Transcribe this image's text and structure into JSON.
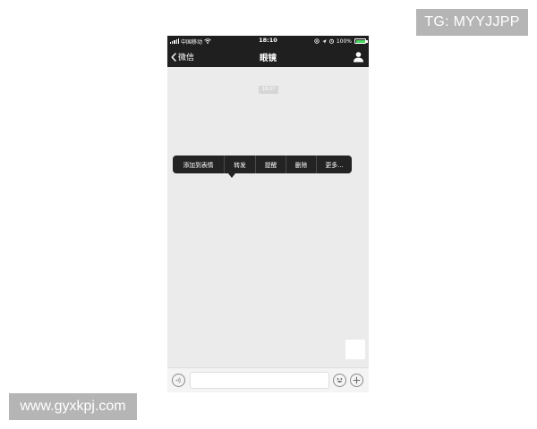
{
  "watermarks": {
    "top": "TG: MYYJJPP",
    "bottom": "www.gyxkpj.com"
  },
  "status_bar": {
    "carrier": "中国移动",
    "time": "18:10",
    "battery": "100%",
    "battery_level": 1.0
  },
  "nav": {
    "back_label": "微信",
    "title": "眼镜"
  },
  "chat": {
    "timestamp": "18:07"
  },
  "context_menu": {
    "items": [
      "添加到表情",
      "转发",
      "提醒",
      "删除",
      "更多..."
    ]
  },
  "input_bar": {
    "message_value": ""
  },
  "icons": {
    "back": "chevron-left-icon",
    "profile": "person-icon",
    "voice": "voice-icon",
    "emoji": "emoji-icon",
    "plus": "plus-icon",
    "wifi": "wifi-icon",
    "location": "location-icon",
    "alarm": "alarm-icon"
  },
  "colors": {
    "nav_bg": "#1f1f1f",
    "chat_bg": "#ebebeb",
    "menu_bg": "#232323",
    "battery": "#4cd964",
    "watermark_bg": "#b5b5b5"
  }
}
